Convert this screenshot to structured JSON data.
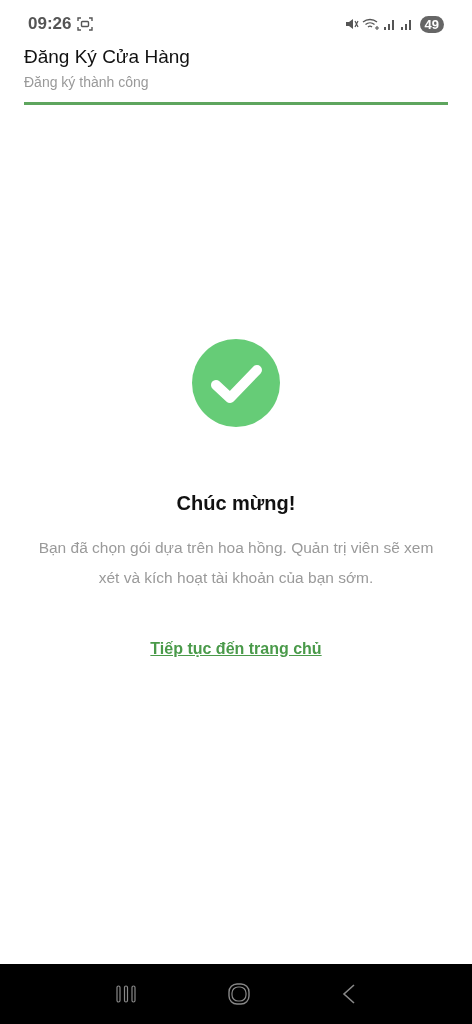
{
  "status_bar": {
    "time": "09:26",
    "battery": "49"
  },
  "header": {
    "title": "Đăng Ký Cửa Hàng",
    "subtitle": "Đăng ký thành công",
    "progress": {
      "level": 1
    }
  },
  "success": {
    "heading": "Chúc mừng!",
    "message": "Bạn đã chọn gói dựa trên hoa hồng. Quản trị viên sẽ xem xét và kích hoạt tài khoản của bạn sớm.",
    "link": "Tiếp tục đến trang chủ"
  }
}
